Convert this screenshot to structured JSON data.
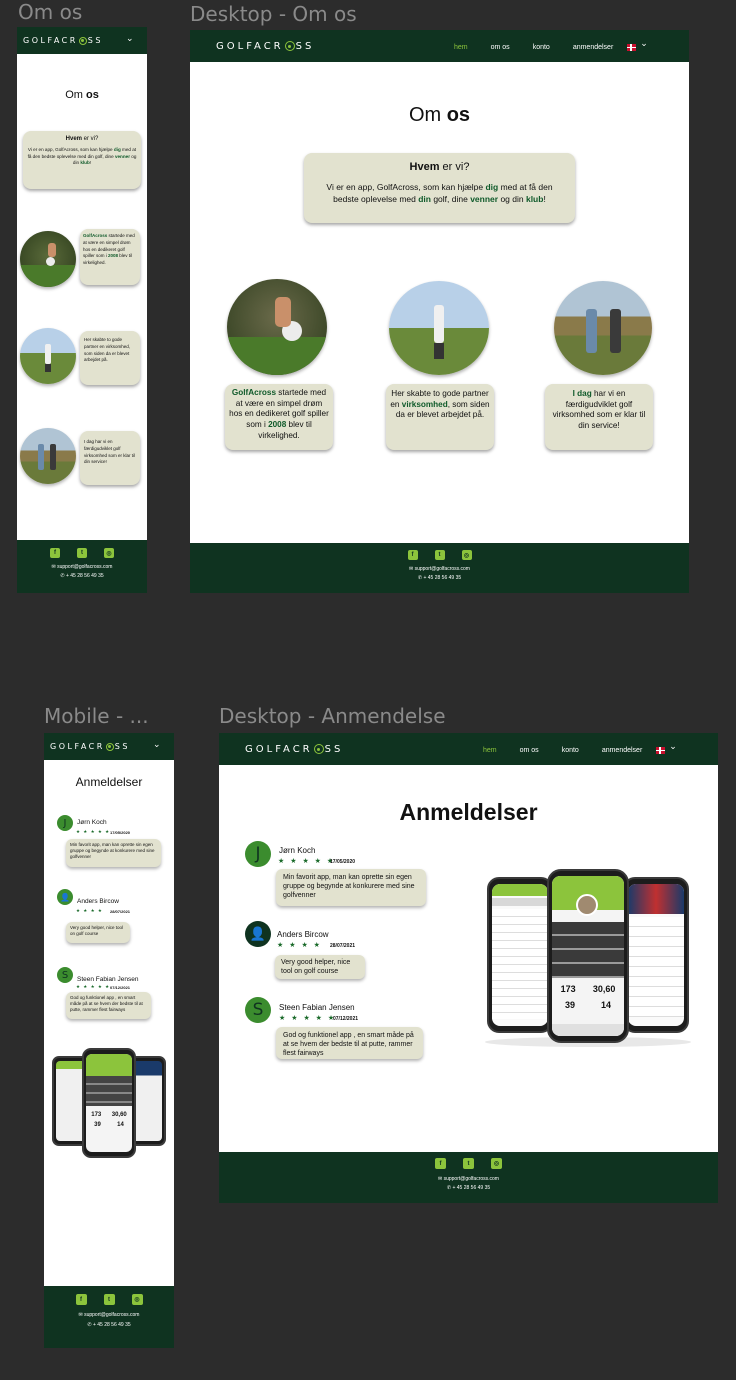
{
  "frames": {
    "mobile_om_os": "Om os",
    "desktop_om_os": "Desktop - Om os",
    "mobile_anmeldelse": "Mobile - ...",
    "desktop_anmeldelse": "Desktop - Anmendelse"
  },
  "brand": {
    "pre": "GOLFACR",
    "post": "SS"
  },
  "colors": {
    "dark_green": "#0f3320",
    "accent_green": "#8cc43c",
    "bubble": "#e2e2cf"
  },
  "nav": {
    "hem": "hem",
    "om_os": "om os",
    "konto": "konto",
    "anmendelser": "anmendelser"
  },
  "footer": {
    "email": "support@golfacross.com",
    "phone": "+ 45 28 56 49 35"
  },
  "om_os": {
    "title_pre": "Om ",
    "title_bold": "os",
    "hvem_bold": "Hvem",
    "hvem_rest": " er vi?",
    "intro": {
      "p1": "Vi er en app, GolfAcross, som kan hjælpe ",
      "dig": "dig",
      "p2": " med at få den bedste oplevelse med ",
      "din": "din",
      "p3": " golf, dine ",
      "venner": "venner",
      "p4": " og din ",
      "klub": "klub",
      "p5": "!"
    },
    "card1": {
      "b1": "GolfAcross",
      "t1": " startede med at være en simpel drøm hos en dedikeret golf spiller som i ",
      "b2": "2008",
      "t2": " blev til virkelighed."
    },
    "card2": {
      "t1": "Her skabte to gode partner en ",
      "b1": "virksomhed",
      "t2": ", som siden da er blevet arbejdet på."
    },
    "card3": {
      "b1": "I dag",
      "t1": " har vi en færdigudviklet golf virksomhed som er klar til din service!"
    }
  },
  "anmeldelser": {
    "title": "Anmeldelser",
    "reviews": [
      {
        "initial": "J",
        "name": "Jørn Koch",
        "stars": "★ ★ ★ ★ ★",
        "date": "17/05/2020",
        "text": "Min favorit app, man kan oprette sin egen gruppe og begynde at konkurere med sine golfvenner"
      },
      {
        "initial": "",
        "name": "Anders Bircow",
        "stars": "★ ★ ★ ★",
        "date": "28/07/2021",
        "text": "Very good helper, nice tool on golf course"
      },
      {
        "initial": "S",
        "name": "Steen Fabian Jensen",
        "stars": "★ ★ ★ ★ ★",
        "date": "07/12/2021",
        "text": "God og funktionel app , en smart måde på at se hvem der bedste til at putte, rammer flest fairways"
      }
    ],
    "mobile_dates": [
      "17/05/2020",
      "28/07/2021",
      "07/12/2021"
    ],
    "stats": {
      "a": "173",
      "b": "30,60",
      "c": "39",
      "d": "14"
    }
  }
}
